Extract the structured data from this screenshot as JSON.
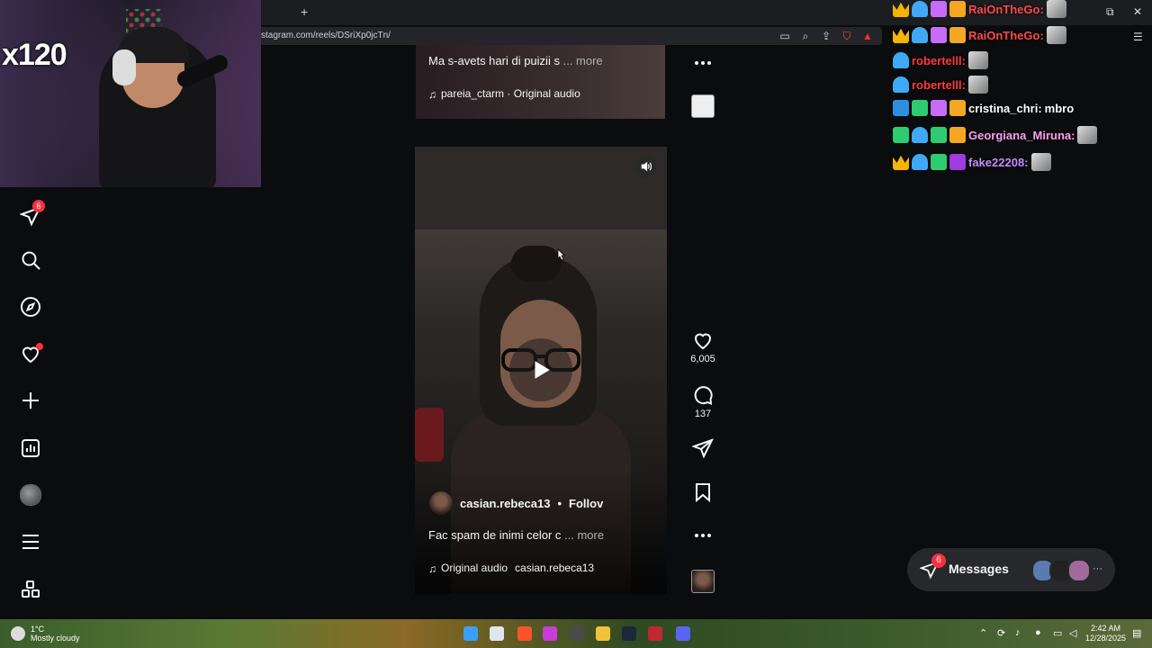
{
  "browser": {
    "url": "stagram.com/reels/DSriXp0jcTn/",
    "new_tab_symbol": "+"
  },
  "stream": {
    "counter": "x120"
  },
  "nav": {
    "messages_badge": "6",
    "icons": [
      "direct-messages-icon",
      "search-icon",
      "explore-icon",
      "notifications-icon",
      "create-icon",
      "dashboard-icon",
      "profile-icon",
      "more-menu-icon",
      "threads-icon"
    ]
  },
  "prev_reel": {
    "caption": "Ma s-avets hari di puizii s",
    "more": "... more",
    "audio": "pareia_ctarm · Original audio"
  },
  "reel": {
    "author": "casian.rebeca13",
    "separator": "•",
    "follow": "Follov",
    "caption": "Fac spam de inimi celor c",
    "more": "... more",
    "audio_prefix": "Original audio",
    "audio_author": "casian.rebeca13",
    "likes": "6,005",
    "comments": "137"
  },
  "chat": {
    "lines": [
      {
        "user": "RaiOnTheGo:",
        "color": "#ff4a4a"
      },
      {
        "user": "RaiOnTheGo:",
        "color": "#ff4a4a"
      },
      {
        "user": "robertelll:",
        "color": "#ff3b3b"
      },
      {
        "user": "robertelll:",
        "color": "#ff3b3b"
      },
      {
        "user": "cristina_chri:",
        "color": "#ffffff",
        "message": "mbro"
      },
      {
        "user": "Georgiana_Miruna:",
        "color": "#ff9ef5"
      },
      {
        "user": "fake22208:",
        "color": "#c98bff"
      }
    ]
  },
  "messages": {
    "label": "Messages",
    "badge": "6",
    "overflow": "···"
  },
  "taskbar": {
    "temp": "1°C",
    "condition": "Mostly cloudy",
    "time": "2:42 AM",
    "date": "12/28/2025"
  },
  "colors": {
    "accent_red": "#ff3040",
    "background": "#0b0c0d",
    "text": "#f5f5f5"
  }
}
